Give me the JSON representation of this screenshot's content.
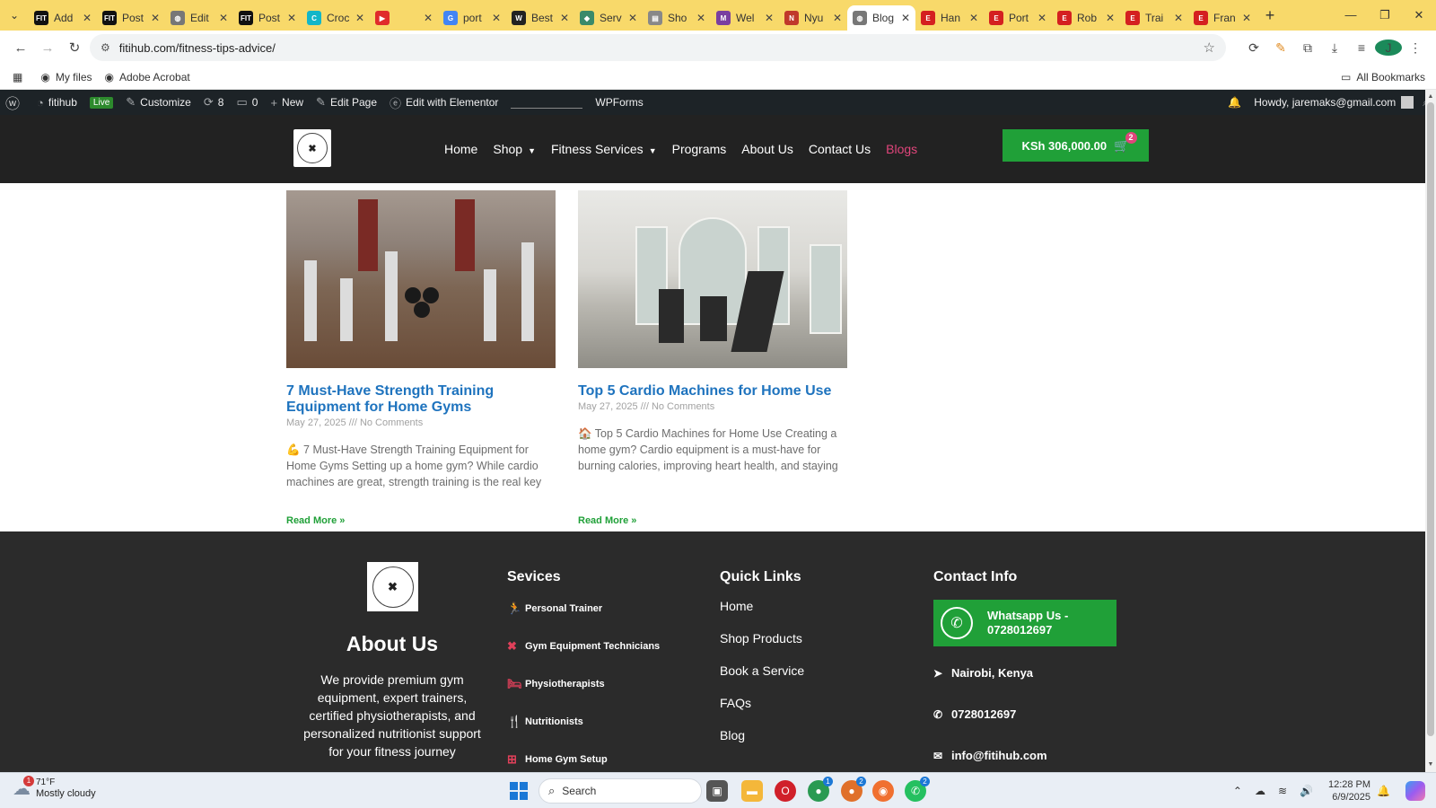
{
  "browser": {
    "tabs": [
      {
        "label": "Add",
        "color": "#111111",
        "glyph": "FIT"
      },
      {
        "label": "Post",
        "color": "#111111",
        "glyph": "FIT"
      },
      {
        "label": "Edit",
        "color": "#777777",
        "glyph": "◍"
      },
      {
        "label": "Post",
        "color": "#111111",
        "glyph": "FIT"
      },
      {
        "label": "Croc",
        "color": "#12b6c8",
        "glyph": "C"
      },
      {
        "label": "",
        "color": "#e02b2b",
        "glyph": "▶"
      },
      {
        "label": "port",
        "color": "#4285f4",
        "glyph": "G"
      },
      {
        "label": "Best",
        "color": "#222222",
        "glyph": "W"
      },
      {
        "label": "Serv",
        "color": "#3a8a6a",
        "glyph": "◆"
      },
      {
        "label": "Sho",
        "color": "#888888",
        "glyph": "▤"
      },
      {
        "label": "Wel",
        "color": "#7a3fa0",
        "glyph": "M"
      },
      {
        "label": "Nyu",
        "color": "#c0392b",
        "glyph": "N"
      },
      {
        "label": "Blog",
        "color": "#777777",
        "glyph": "◍",
        "active": true
      },
      {
        "label": "Han",
        "color": "#d42020",
        "glyph": "E"
      },
      {
        "label": "Port",
        "color": "#d42020",
        "glyph": "E"
      },
      {
        "label": "Rob",
        "color": "#d42020",
        "glyph": "E"
      },
      {
        "label": "Trai",
        "color": "#d42020",
        "glyph": "E"
      },
      {
        "label": "Fran",
        "color": "#d42020",
        "glyph": "E"
      }
    ],
    "url": "fitihub.com/fitness-tips-advice/",
    "bookmarks": {
      "my_files": "My files",
      "adobe": "Adobe Acrobat",
      "all": "All Bookmarks"
    }
  },
  "wpbar": {
    "site_name": "fitihub",
    "live": "Live",
    "customize": "Customize",
    "updates": "8",
    "comments": "0",
    "new": "New",
    "edit_page": "Edit Page",
    "elementor": "Edit with Elementor",
    "wpforms": "WPForms",
    "howdy": "Howdy, jaremaks@gmail.com"
  },
  "header": {
    "nav": {
      "home": "Home",
      "shop": "Shop",
      "fitness_services": "Fitness Services",
      "programs": "Programs",
      "about": "About Us",
      "contact": "Contact Us",
      "blogs": "Blogs"
    },
    "cart_total": "KSh 306,000.00",
    "cart_count": "2",
    "accent": "#e0457b",
    "brand_green": "#20a038"
  },
  "posts": [
    {
      "title": "7 Must-Have Strength Training Equipment for Home Gyms",
      "date": "May 27, 2025",
      "comments": "No Comments",
      "excerpt": "💪 7 Must-Have Strength Training Equipment for Home Gyms Setting up a home gym? While cardio machines are great, strength training is the real key",
      "read_more": "Read More »"
    },
    {
      "title": "Top 5 Cardio Machines for Home Use",
      "date": "May 27, 2025",
      "comments": "No Comments",
      "excerpt": "🏠 Top 5 Cardio Machines for Home Use Creating a home gym? Cardio equipment is a must-have for burning calories, improving heart health, and staying",
      "read_more": "Read More »"
    }
  ],
  "footer": {
    "about_heading": "About Us",
    "about_text": "We provide premium gym equipment, expert trainers, certified physiotherapists, and personalized nutritionist support for your fitness journey",
    "services_heading": "Sevices",
    "services": [
      {
        "label": "Personal Trainer",
        "icon": "running-icon",
        "glyph": "🏃"
      },
      {
        "label": "Gym Equipment Technicians",
        "icon": "tools-icon",
        "glyph": "✖"
      },
      {
        "label": "Physiotherapists",
        "icon": "bed-icon",
        "glyph": "🛏"
      },
      {
        "label": "Nutritionists",
        "icon": "utensils-icon",
        "glyph": "🍴"
      },
      {
        "label": "Home Gym Setup",
        "icon": "dumbbell-icon",
        "glyph": "⊞"
      }
    ],
    "quick_links_heading": "Quick Links",
    "quick_links": [
      "Home",
      "Shop Products",
      "Book a Service",
      "FAQs",
      "Blog"
    ],
    "contact_heading": "Contact Info",
    "whatsapp": "Whatsapp Us - 0728012697",
    "location": "Nairobi, Kenya",
    "phone": "0728012697",
    "email": "info@fitihub.com"
  },
  "taskbar": {
    "temp": "71°F",
    "weather": "Mostly cloudy",
    "weather_badge": "1",
    "search": "Search",
    "time": "12:28 PM",
    "date": "6/9/2025",
    "chrome_badge_1": "1",
    "chrome_badge_2": "2",
    "whatsapp_badge": "2"
  }
}
